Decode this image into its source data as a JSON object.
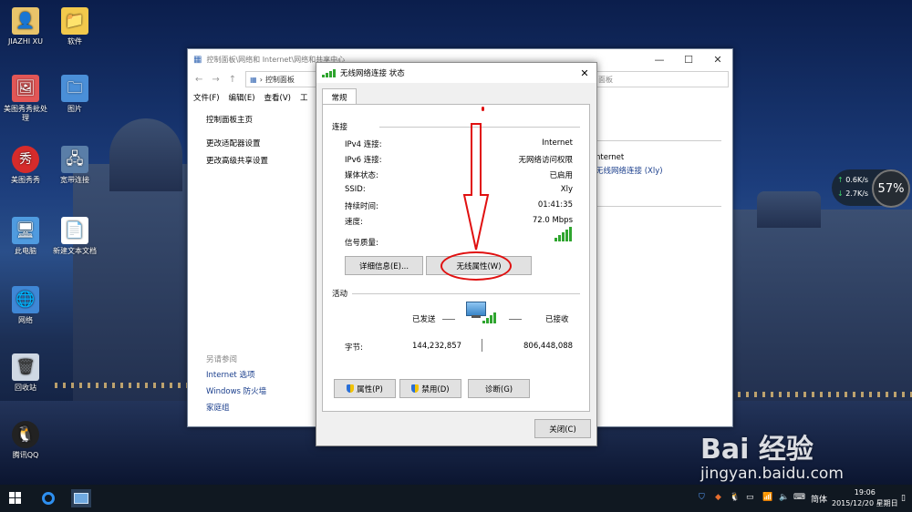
{
  "desktop_icons": [
    {
      "label": "JIAZHI XU",
      "icon": "user-folder-icon"
    },
    {
      "label": "软件",
      "icon": "folder-icon"
    },
    {
      "label": "美图秀秀批处理",
      "icon": "meitu-batch-icon"
    },
    {
      "label": "图片",
      "icon": "pictures-folder-icon"
    },
    {
      "label": "美图秀秀",
      "icon": "meitu-icon"
    },
    {
      "label": "宽带连接",
      "icon": "broadband-icon"
    },
    {
      "label": "此电脑",
      "icon": "computer-icon"
    },
    {
      "label": "新建文本文档",
      "icon": "text-document-icon"
    },
    {
      "label": "网络",
      "icon": "network-icon"
    },
    {
      "label": "回收站",
      "icon": "recycle-bin-icon"
    },
    {
      "label": "腾讯QQ",
      "icon": "qq-icon"
    }
  ],
  "explorer": {
    "title": "控制面板\\网络和 Internet\\网络和共享中心",
    "address": "控制面板",
    "search_placeholder": "面板",
    "menu": [
      "文件(F)",
      "编辑(E)",
      "查看(V)",
      "工"
    ],
    "left_links": [
      "控制面板主页",
      "更改适配器设置",
      "更改高级共享设置"
    ],
    "see_also_heading": "另请参阅",
    "see_also_links": [
      "Internet 选项",
      "Windows 防火墙",
      "家庭组"
    ],
    "right_label": "nternet",
    "right_link": "无线网络连接 (Xly)"
  },
  "dialog": {
    "title": "无线网络连接 状态",
    "tab": "常规",
    "connection_heading": "连接",
    "rows": [
      {
        "key": "IPv4 连接:",
        "value": "Internet"
      },
      {
        "key": "IPv6 连接:",
        "value": "无网络访问权限"
      },
      {
        "key": "媒体状态:",
        "value": "已启用"
      },
      {
        "key": "SSID:",
        "value": "Xly"
      },
      {
        "key": "持续时间:",
        "value": "01:41:35"
      },
      {
        "key": "速度:",
        "value": "72.0 Mbps"
      }
    ],
    "signal_label": "信号质量:",
    "details_button": "详细信息(E)...",
    "wireless_props_button": "无线属性(W)",
    "activity_heading": "活动",
    "sent_label": "已发送",
    "received_label": "已接收",
    "bytes_label": "字节:",
    "bytes_sent": "144,232,857",
    "bytes_received": "806,448,088",
    "properties_button": "属性(P)",
    "disable_button": "禁用(D)",
    "diagnose_button": "诊断(G)",
    "close_button": "关闭(C)"
  },
  "net_widget": {
    "up": "0.6K/s",
    "down": "2.7K/s",
    "percent": "57%"
  },
  "watermark": {
    "logo": "Bai 经验",
    "url": "jingyan.baidu.com"
  },
  "taskbar": {
    "ime": "简体",
    "time": "19:06",
    "date": "2015/12/20 星期日"
  },
  "colors": {
    "accent_red": "#e01010",
    "link_blue": "#1a3e8c",
    "signal_green": "#2fa52f"
  }
}
